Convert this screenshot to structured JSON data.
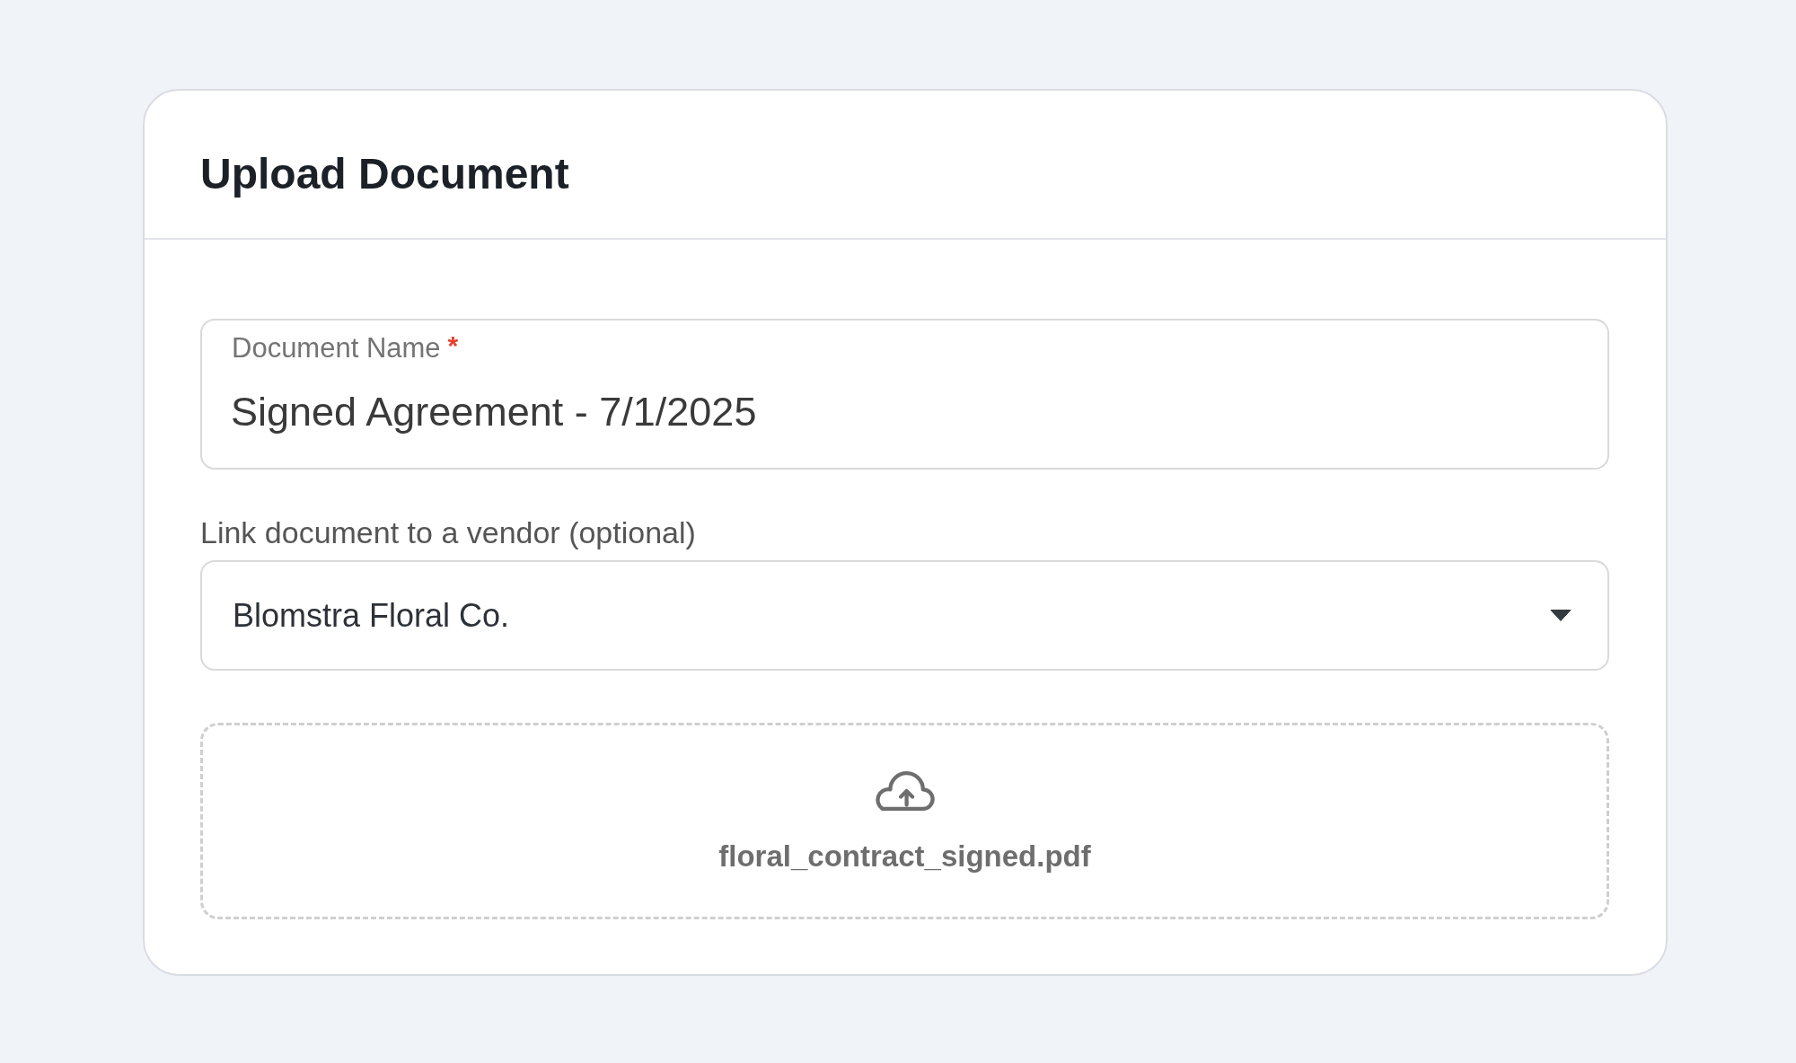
{
  "card": {
    "title": "Upload Document"
  },
  "document_name": {
    "label": "Document Name",
    "required_mark": "*",
    "value": "Signed Agreement - 7/1/2025"
  },
  "vendor": {
    "label": "Link document to a vendor (optional)",
    "value": "Blomstra Floral Co."
  },
  "upload": {
    "file_name": "floral_contract_signed.pdf"
  }
}
